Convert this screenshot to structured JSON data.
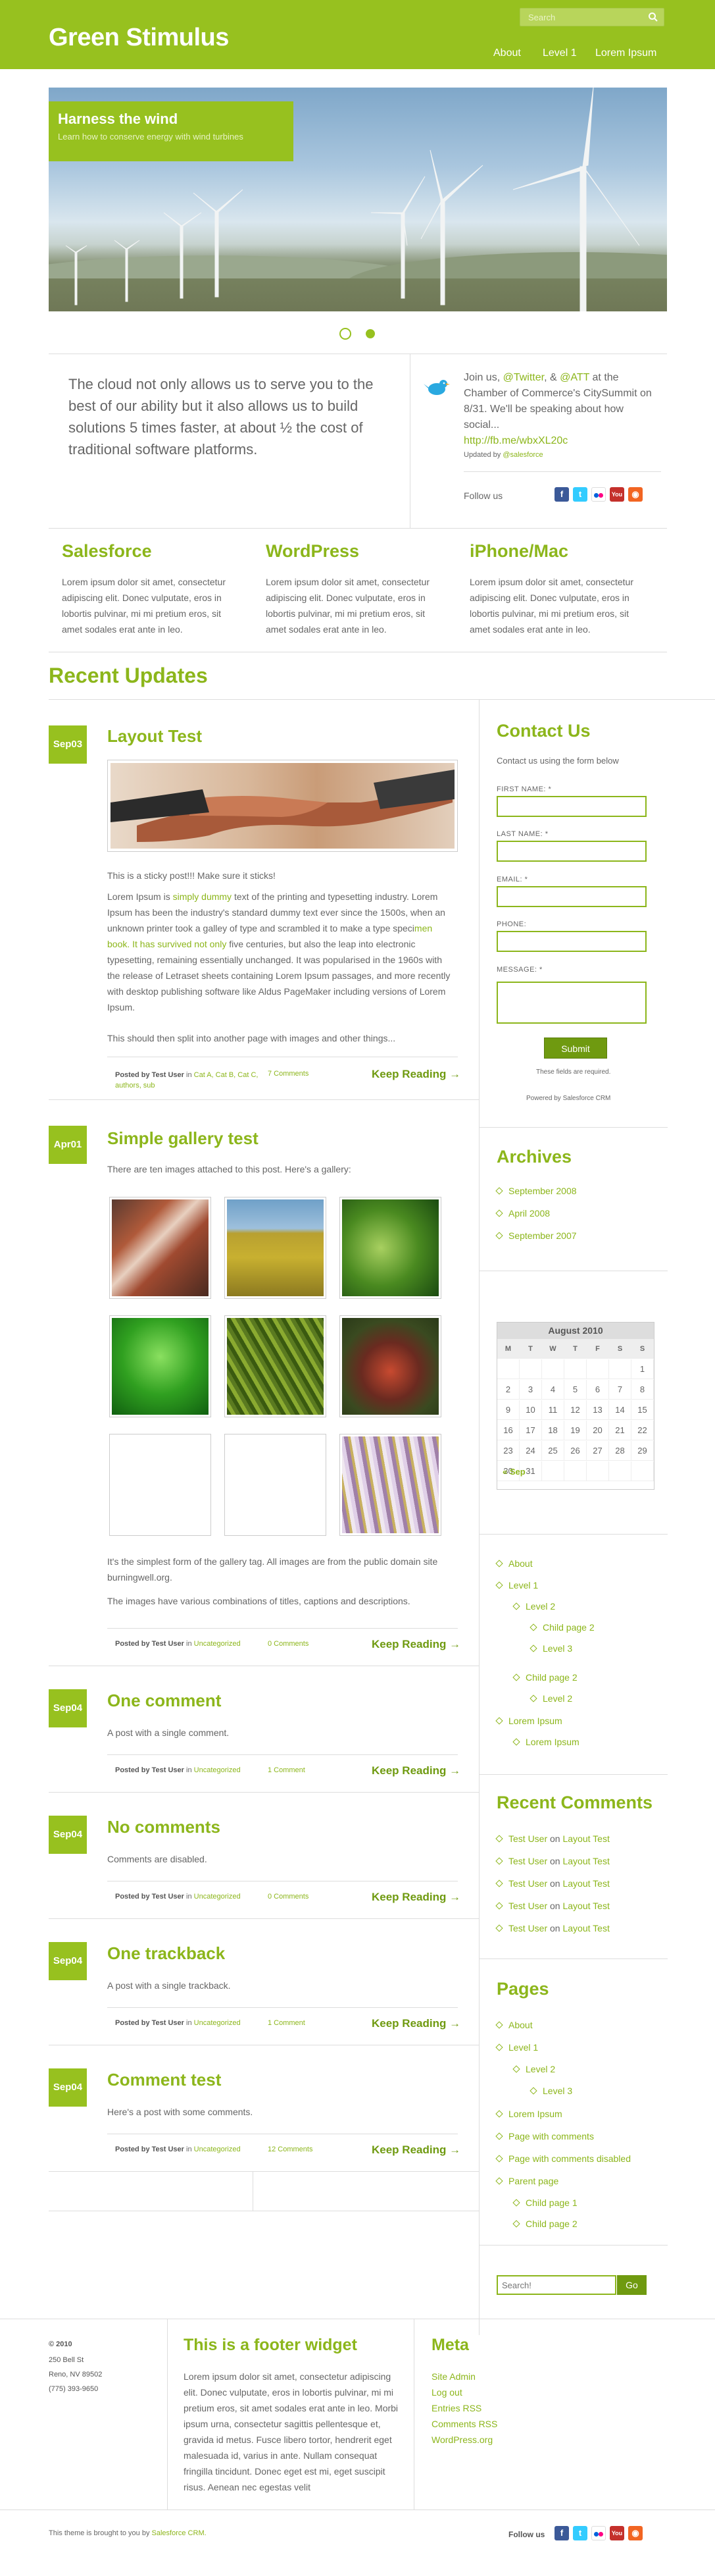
{
  "header": {
    "site_title": "Green Stimulus",
    "search_placeholder": "Search",
    "nav": [
      "About",
      "Level 1",
      "Lorem Ipsum"
    ]
  },
  "slider": {
    "title": "Harness the wind",
    "subtitle": "Learn how to conserve energy with wind turbines"
  },
  "intro": {
    "text": "The cloud not only allows us to serve you to the best of our ability but it also allows us to build solutions 5 times faster, at about ½ the cost of traditional software platforms."
  },
  "tweet": {
    "text_before": "Join us, ",
    "mention1": "@Twitter",
    "text_mid1": ", & ",
    "mention2": "@ATT",
    "text_mid2": " at the Chamber of Commerce's CitySummit on 8/31. We'll be speaking about how social...",
    "link": "http://fb.me/wbxXL20c",
    "updated_by": "Updated by ",
    "updated_user": "@salesforce",
    "follow_label": "Follow us"
  },
  "columns": [
    {
      "title": "Salesforce",
      "text": "Lorem ipsum dolor sit amet, consectetur adipiscing elit. Donec vulputate, eros in lobortis pulvinar, mi mi pretium eros, sit amet sodales erat ante in leo."
    },
    {
      "title": "WordPress",
      "text": "Lorem ipsum dolor sit amet, consectetur adipiscing elit. Donec vulputate, eros in lobortis pulvinar, mi mi pretium eros, sit amet sodales erat ante in leo."
    },
    {
      "title": "iPhone/Mac",
      "text": "Lorem ipsum dolor sit amet, consectetur adipiscing elit. Donec vulputate, eros in lobortis pulvinar, mi mi pretium eros, sit amet sodales erat ante in leo."
    }
  ],
  "recent_title": "Recent Updates",
  "posts": [
    {
      "date": "Sep03",
      "title": "Layout Test",
      "sticky": "This is a sticky post!!! Make sure it sticks!",
      "p1_a": "Lorem Ipsum is ",
      "p1_link": "simply dummy",
      "p1_b": " text of the printing and typesetting industry. Lorem Ipsum has been the industry's standard dummy text ever since the 1500s, when an unknown printer took a galley of type and scrambled it to make a type speci",
      "p1_link2": "men book. It has survived not only",
      "p1_c": " five centuries, but also the leap into electronic typesetting, remaining essentially unchanged. It was popularised in the 1960s with the release of Letraset sheets containing Lorem Ipsum passages, and more recently with desktop publishing software like Aldus PageMaker including versions of Lorem Ipsum.",
      "p2": "This should then split into another page with images and other things...",
      "meta_by": "Posted by Test User",
      "meta_in": " in ",
      "meta_cats": "Cat A, Cat B, Cat C, authors, sub",
      "comments": "7 Comments",
      "keep": "Keep Reading →"
    },
    {
      "date": "Apr01",
      "title": "Simple gallery test",
      "intro": "There are ten images attached to this post.  Here's a gallery:",
      "p1": "It's the simplest form of the gallery tag.  All images are from the public domain site burningwell.org.",
      "p2": "The images have various combinations of titles, captions and descriptions.",
      "meta_by": "Posted by Test User",
      "meta_in": " in ",
      "meta_cats": "Uncategorized",
      "comments": "0 Comments",
      "keep": "Keep Reading →"
    },
    {
      "date": "Sep04",
      "title": "One comment",
      "text": "A post with a single comment.",
      "meta_by": "Posted by Test User",
      "meta_in": " in ",
      "meta_cats": "Uncategorized",
      "comments": "1 Comment",
      "keep": "Keep Reading →"
    },
    {
      "date": "Sep04",
      "title": "No comments",
      "text": "Comments are disabled.",
      "meta_by": "Posted by Test User",
      "meta_in": " in ",
      "meta_cats": "Uncategorized",
      "comments": "0 Comments",
      "keep": "Keep Reading →"
    },
    {
      "date": "Sep04",
      "title": "One trackback",
      "text": "A post with a single trackback.",
      "meta_by": "Posted by Test User",
      "meta_in": " in ",
      "meta_cats": "Uncategorized",
      "comments": "1 Comment",
      "keep": "Keep Reading →"
    },
    {
      "date": "Sep04",
      "title": "Comment test",
      "text": "Here's a post with some comments.",
      "meta_by": "Posted by Test User",
      "meta_in": " in ",
      "meta_cats": "Uncategorized",
      "comments": "12 Comments",
      "keep": "Keep Reading →"
    }
  ],
  "contact": {
    "title": "Contact Us",
    "intro": "Contact us using the form below",
    "fields": [
      "FIRST NAME: *",
      "LAST NAME: *",
      "EMAIL: *",
      "PHONE:",
      "MESSAGE: *"
    ],
    "submit": "Submit",
    "required": "These fields are required.",
    "powered": "Powered by Salesforce CRM"
  },
  "archives": {
    "title": "Archives",
    "items": [
      "September 2008",
      "April 2008",
      "September 2007"
    ]
  },
  "calendar": {
    "month": "August 2010",
    "days": [
      "M",
      "T",
      "W",
      "T",
      "F",
      "S",
      "S"
    ],
    "cells": [
      "",
      "",
      "",
      "",
      "",
      "",
      "1",
      "2",
      "3",
      "4",
      "5",
      "6",
      "7",
      "8",
      "9",
      "10",
      "11",
      "12",
      "13",
      "14",
      "15",
      "16",
      "17",
      "18",
      "19",
      "20",
      "21",
      "22",
      "23",
      "24",
      "25",
      "26",
      "27",
      "28",
      "29",
      "30",
      "31",
      "",
      "",
      "",
      "",
      ""
    ],
    "prev": "« Sep"
  },
  "pages_menu": [
    {
      "label": "About",
      "level": 0
    },
    {
      "label": "Level 1",
      "level": 0
    },
    {
      "label": "Level 2",
      "level": 1
    },
    {
      "label": "Child page 2",
      "level": 2
    },
    {
      "label": "Level 3",
      "level": 2
    },
    {
      "label": "Child page 2",
      "level": 1
    },
    {
      "label": "Level 2",
      "level": 2
    },
    {
      "label": "Lorem Ipsum",
      "level": 0
    },
    {
      "label": "Lorem Ipsum",
      "level": 1
    }
  ],
  "recent_comments": {
    "title": "Recent Comments",
    "user": "Test User",
    "on": " on ",
    "post": "Layout Test",
    "count": 5
  },
  "pages": {
    "title": "Pages",
    "items": [
      {
        "label": "About",
        "level": 0
      },
      {
        "label": "Level 1",
        "level": 0
      },
      {
        "label": "Level 2",
        "level": 1
      },
      {
        "label": "Level 3",
        "level": 2
      },
      {
        "label": "Lorem Ipsum",
        "level": 0
      },
      {
        "label": "Page with comments",
        "level": 0
      },
      {
        "label": "Page with comments disabled",
        "level": 0
      },
      {
        "label": "Parent page",
        "level": 0
      },
      {
        "label": "Child page 1",
        "level": 1
      },
      {
        "label": "Child page 2",
        "level": 1
      }
    ]
  },
  "side_search": {
    "placeholder": "Search!",
    "button": "Go"
  },
  "footer": {
    "copyright": "© 2010",
    "address1": "250 Bell St",
    "address2": "Reno, NV 89502",
    "phone": "(775) 393-9650",
    "widget_title": "This is a footer widget",
    "widget_text": "Lorem ipsum dolor sit amet, consectetur adipiscing elit. Donec vulputate, eros in lobortis pulvinar, mi mi pretium eros, sit amet sodales erat ante in leo. Morbi ipsum urna, consectetur sagittis pellentesque et, gravida id metus. Fusce libero tortor, hendrerit eget malesuada id, varius in ante. Nullam consequat fringilla tincidunt. Donec eget est mi, eget suscipit risus. Aenean nec egestas velit",
    "meta_title": "Meta",
    "meta_links": [
      "Site Admin",
      "Log out",
      "Entries RSS",
      "Comments RSS",
      "WordPress.org"
    ],
    "brought": "This theme is brought to you by ",
    "brought_link": "Salesforce CRM.",
    "follow": "Follow us"
  },
  "colors": {
    "accent": "#97c11f",
    "link": "#8cb61b"
  }
}
